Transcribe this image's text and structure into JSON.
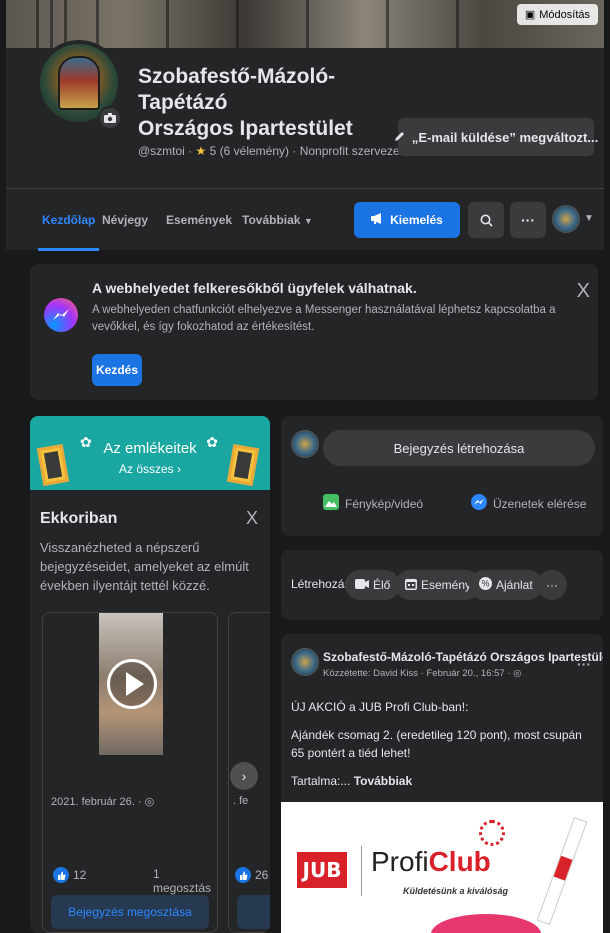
{
  "cover": {
    "edit_label": "Módosítás"
  },
  "page": {
    "name_line1": "Szobafestő-Mázoló-Tapétázó",
    "name_line2": "Országos Ipartestület",
    "handle": "@szmtoi",
    "rating": "5 (6 vélemény)",
    "category": "Nonprofit szervezet",
    "email_button": "„E-mail küldése” megváltozt..."
  },
  "nav": {
    "tabs": [
      "Kezdőlap",
      "Névjegy",
      "Események",
      "Továbbiak"
    ],
    "promote_label": "Kiemelés"
  },
  "messenger": {
    "title": "A webhelyedet felkeresőkből ügyfelek válhatnak.",
    "text": "A webhelyeden chatfunkciót elhelyezve a Messenger használatával léphetsz kapcsolatba a vevőkkel, és így fokozhatod az értékesítést.",
    "button": "Kezdés"
  },
  "memories": {
    "banner_title": "Az emlékeitek",
    "banner_link": "Az összes ›",
    "heading": "Ekkoriban",
    "description": "Visszanézheted a népszerű bejegyzéseidet, amelyeket az elmúlt években ilyentájt tettél közzé.",
    "items": [
      {
        "date": "2021. február 26. ·",
        "likes": "12",
        "shares": "1 megosztás",
        "button": "Bejegyzés megosztása"
      },
      {
        "date": ". fe",
        "likes": "26"
      }
    ]
  },
  "create_post": {
    "placeholder": "Bejegyzés létrehozása",
    "photo_label": "Fénykép/videó",
    "messages_label": "Üzenetek elérése"
  },
  "create_chips": {
    "label": "Létrehozás",
    "live": "Élő",
    "event": "Esemény",
    "offer": "Ajánlat"
  },
  "post": {
    "author": "Szobafestő-Mázoló-Tapétázó Országos Ipartestület",
    "meta": "Közzétette: David Kiss · Február 20., 16:57 ·",
    "line1": "ÚJ AKCIÓ a JUB Profi Club-ban!:",
    "line2": "Ajándék csomag 2. (eredetileg 120 pont), most csupán 65 pontért a tiéd lehet!",
    "line3_prefix": "Tartalma:... ",
    "line3_more": "Továbbiak",
    "image": {
      "jub": "JUB",
      "profi": "Profi",
      "club": "Club",
      "tagline": "Küldetésünk a kiválóság"
    }
  },
  "colors": {
    "accent": "#2d88ff",
    "button_blue": "#1b74e4",
    "card_bg": "#242526",
    "page_bg": "#18191a",
    "banner_teal": "#1aa7a1"
  }
}
